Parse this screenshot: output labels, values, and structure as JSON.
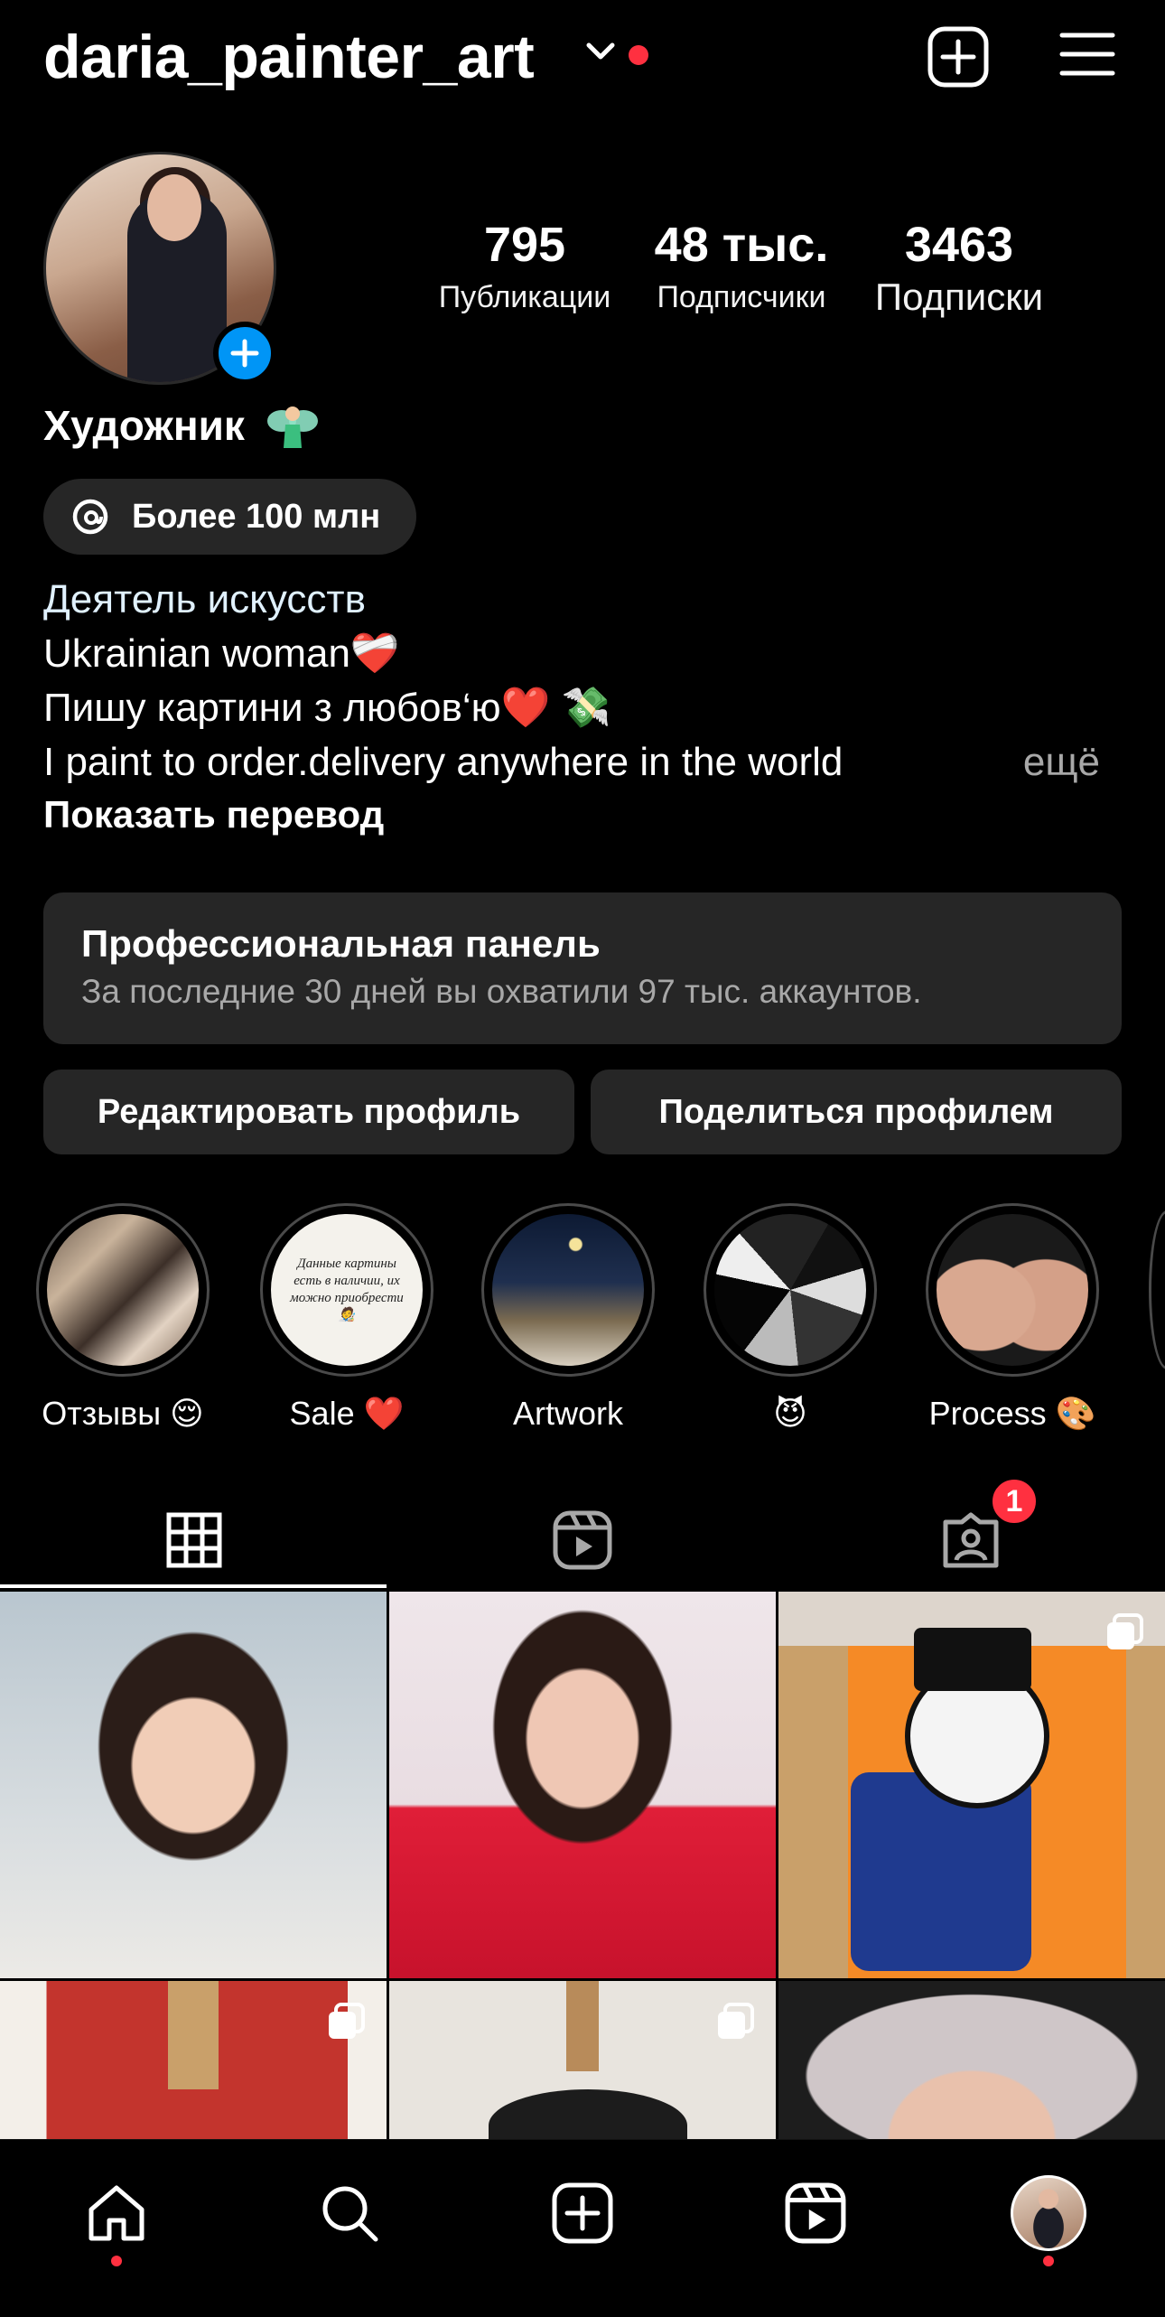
{
  "header": {
    "username": "daria_painter_art",
    "notification_dot_color": "#ff3040"
  },
  "profile": {
    "stats": [
      {
        "value": "795",
        "label": "Публикации"
      },
      {
        "value": "48 тыс.",
        "label": "Подписчики"
      },
      {
        "value": "3463",
        "label": "Подписки"
      }
    ],
    "display_name": "Художник",
    "threads_badge": "Более 100 млн",
    "bio": {
      "category": "Деятель искусств",
      "line1": "Ukrainian woman❤️‍🩹",
      "line2": "Пишу картини з любов‘ю❤️ 💸",
      "line3": "I paint to order.delivery anywhere in the world",
      "more": "ещё"
    },
    "show_translation": "Показать перевод"
  },
  "pro_panel": {
    "title": "Профессиональная панель",
    "subtitle": "За последние 30 дней вы охватили 97 тыс. аккаунтов."
  },
  "buttons": {
    "edit_profile": "Редактировать профиль",
    "share_profile": "Поделиться профилем"
  },
  "highlights": [
    {
      "label": "Отзывы 😌"
    },
    {
      "label": "Sale ❤️",
      "cover_text": "Данные картины есть в наличии, их можно приобрести 🧑‍🎨"
    },
    {
      "label": "Artwork"
    },
    {
      "label": "😈"
    },
    {
      "label": "Process 🎨"
    }
  ],
  "tabs": {
    "active": "grid",
    "tagged_badge": "1"
  },
  "grid_posts": [
    {
      "id": 1,
      "multi": false
    },
    {
      "id": 2,
      "multi": false
    },
    {
      "id": 3,
      "multi": true
    },
    {
      "id": 4,
      "multi": true
    },
    {
      "id": 5,
      "multi": true
    },
    {
      "id": 6,
      "multi": false
    }
  ],
  "bottom_nav": [
    "home-icon",
    "search-icon",
    "create-icon",
    "reels-icon",
    "profile-avatar"
  ],
  "colors": {
    "accent_blue": "#0095f6",
    "panel": "#262626",
    "badge_red": "#ff3040"
  }
}
